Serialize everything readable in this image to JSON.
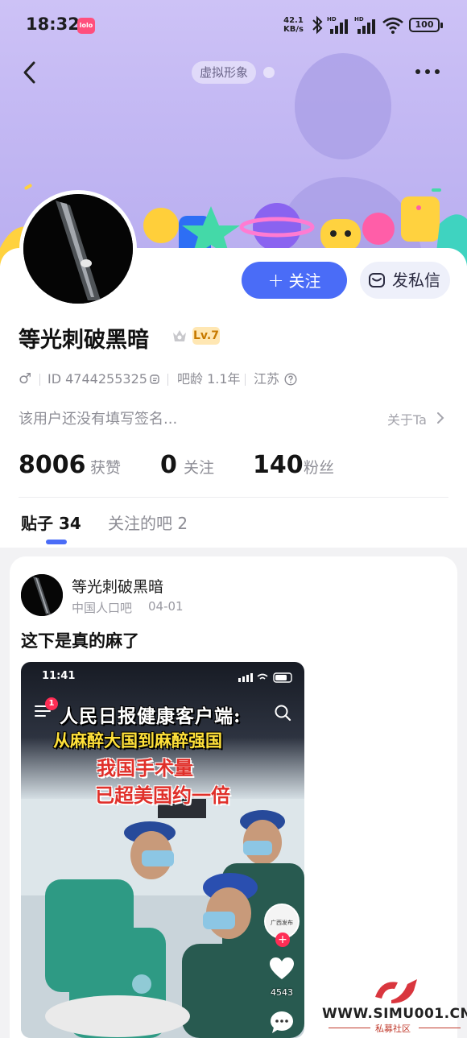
{
  "status_bar": {
    "time": "18:32",
    "app_badge": "lolo",
    "net_speed_value": "42.1",
    "net_speed_unit": "KB/s",
    "battery": "100"
  },
  "header": {
    "virtual_tag": "虚拟形象"
  },
  "profile": {
    "username": "等光刺破黑暗",
    "level": "Lv.7",
    "gender_symbol": "♂",
    "id_text": "ID 4744255325",
    "bar_age": "吧龄 1.1年",
    "location": "江苏",
    "signature": "该用户还没有填写签名...",
    "about_link": "关于Ta",
    "follow_label": "关注",
    "follow_plus": "+",
    "message_label": "发私信"
  },
  "stats": {
    "likes_value": "8006",
    "likes_label": "获赞",
    "following_value": "0",
    "following_label": "关注",
    "fans_value": "140",
    "fans_label": "粉丝"
  },
  "tabs": [
    {
      "label": "贴子 34",
      "active": true
    },
    {
      "label": "关注的吧 2",
      "active": false
    }
  ],
  "post": {
    "author": "等光刺破黑暗",
    "forum": "中国人口吧",
    "date": "04-01",
    "title": "这下是真的麻了",
    "image": {
      "status_time": "11:41",
      "notification_count": "1",
      "caption_line1": "人民日报健康客户端:",
      "caption_line2": "从麻醉大国到麻醉强国",
      "caption_line3": "我国手术量",
      "caption_line4": "已超美国约一倍",
      "channel_name": "广西发布",
      "like_count": "4543"
    }
  },
  "watermark": {
    "text": "WWW.SIMU001.CN",
    "sub": "私募社区"
  },
  "colors": {
    "accent": "#4a6cf7",
    "banner": "#c3b8f3",
    "level_bg": "#ffe7b3",
    "level_text": "#c77a00"
  }
}
